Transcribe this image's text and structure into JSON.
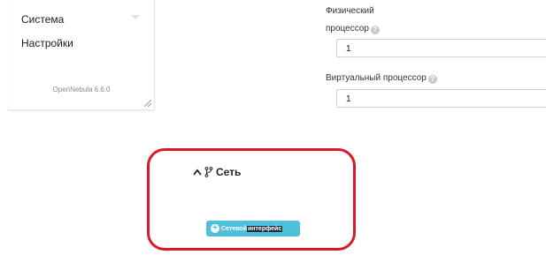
{
  "sidebar": {
    "items": [
      {
        "label": "Система"
      },
      {
        "label": "Настройки"
      }
    ],
    "version": "OpenNebula 6.6.0"
  },
  "form": {
    "physical_cpu": {
      "label_line1": "Физический",
      "label_line2": "процессор",
      "value": "1"
    },
    "virtual_cpu": {
      "label": "Виртуальный процессор",
      "value": "1"
    }
  },
  "network": {
    "title": "Сеть",
    "add_button": {
      "word1": "Сетевой",
      "word2": "интерфейс"
    }
  },
  "icons": {
    "help": "question-circle-icon",
    "chevron": "chevron-up-icon",
    "network": "branch-icon",
    "add": "plus-circle-icon"
  },
  "colors": {
    "highlight": "#d9192a",
    "button": "#4fc0dc"
  }
}
